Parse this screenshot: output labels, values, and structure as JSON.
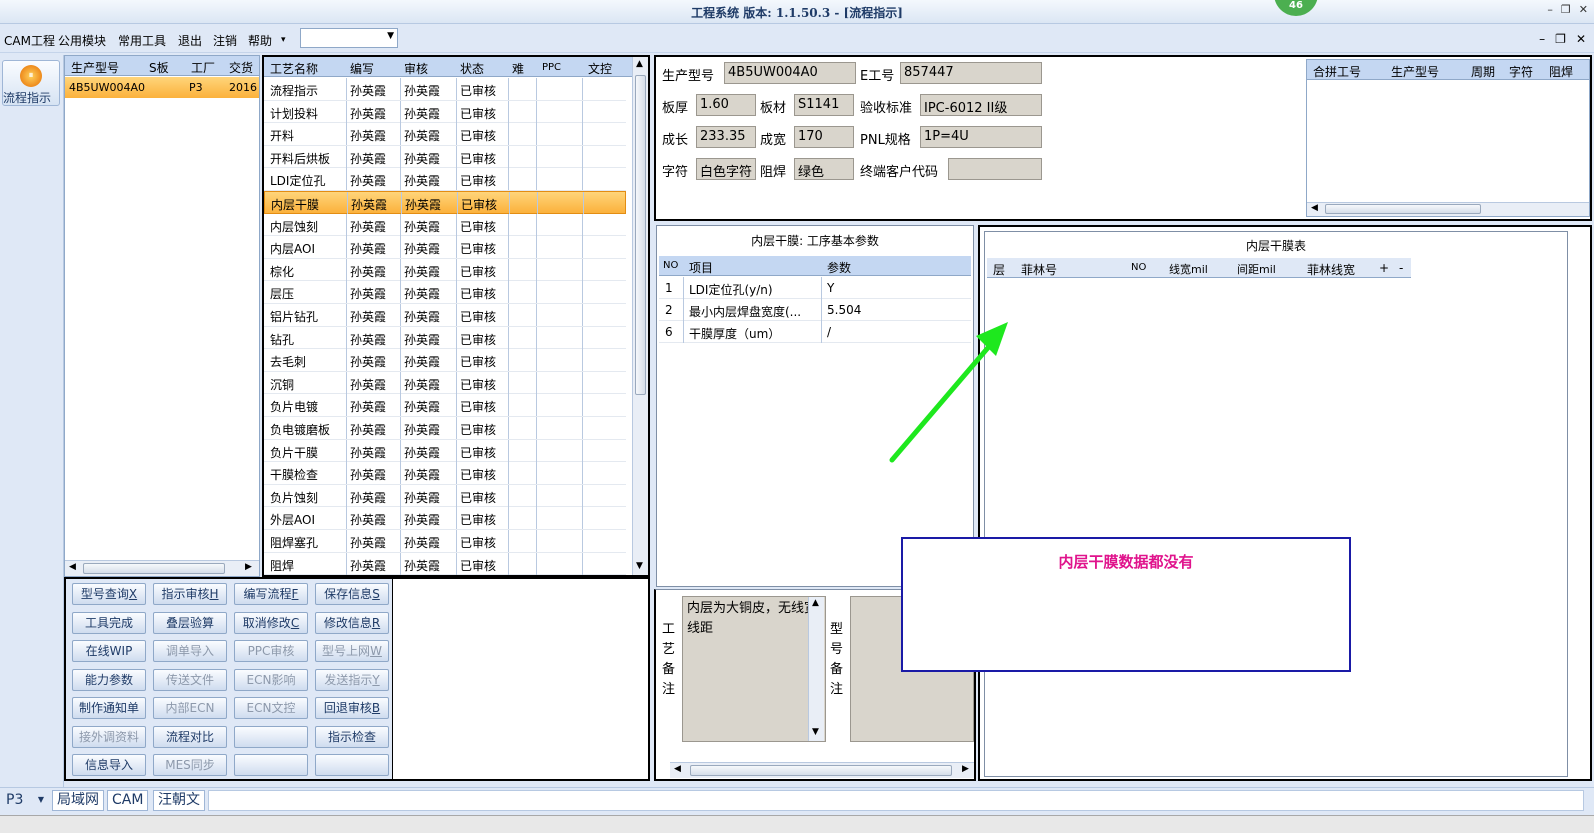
{
  "window": {
    "title": "工程系统    版本: 1.1.50.3 - [流程指示]",
    "badge": "46",
    "controls": [
      "–",
      "❐",
      "✕"
    ]
  },
  "menu": {
    "items": [
      "CAM工程",
      "公用模块",
      "常用工具",
      "退出",
      "注销",
      "帮助"
    ],
    "help_arrow": "▾",
    "combo_value": "",
    "mdi_controls": [
      "–",
      "❐",
      "✕"
    ]
  },
  "nav": {
    "flow_label": "流程指示"
  },
  "model_grid": {
    "headers": [
      "生产型号",
      "S板",
      "工厂",
      "交货日"
    ],
    "rows": [
      {
        "model": "4B5UW004A0",
        "s": "",
        "factory": "P3",
        "date": "2016"
      }
    ]
  },
  "process_grid": {
    "headers": [
      "工艺名称",
      "编写",
      "审核",
      "状态",
      "难",
      "PPC",
      "文控"
    ],
    "rows": [
      {
        "name": "流程指示",
        "writer": "孙英霞",
        "reviewer": "孙英霞",
        "status": "已审核"
      },
      {
        "name": "计划投料",
        "writer": "孙英霞",
        "reviewer": "孙英霞",
        "status": "已审核"
      },
      {
        "name": "开料",
        "writer": "孙英霞",
        "reviewer": "孙英霞",
        "status": "已审核"
      },
      {
        "name": "开料后烘板",
        "writer": "孙英霞",
        "reviewer": "孙英霞",
        "status": "已审核"
      },
      {
        "name": "LDI定位孔",
        "writer": "孙英霞",
        "reviewer": "孙英霞",
        "status": "已审核"
      },
      {
        "name": "内层干膜",
        "writer": "孙英霞",
        "reviewer": "孙英霞",
        "status": "已审核"
      },
      {
        "name": "内层蚀刻",
        "writer": "孙英霞",
        "reviewer": "孙英霞",
        "status": "已审核"
      },
      {
        "name": "内层AOI",
        "writer": "孙英霞",
        "reviewer": "孙英霞",
        "status": "已审核"
      },
      {
        "name": "棕化",
        "writer": "孙英霞",
        "reviewer": "孙英霞",
        "status": "已审核"
      },
      {
        "name": "层压",
        "writer": "孙英霞",
        "reviewer": "孙英霞",
        "status": "已审核"
      },
      {
        "name": "铝片钻孔",
        "writer": "孙英霞",
        "reviewer": "孙英霞",
        "status": "已审核"
      },
      {
        "name": "钻孔",
        "writer": "孙英霞",
        "reviewer": "孙英霞",
        "status": "已审核"
      },
      {
        "name": "去毛刺",
        "writer": "孙英霞",
        "reviewer": "孙英霞",
        "status": "已审核"
      },
      {
        "name": "沉铜",
        "writer": "孙英霞",
        "reviewer": "孙英霞",
        "status": "已审核"
      },
      {
        "name": "负片电镀",
        "writer": "孙英霞",
        "reviewer": "孙英霞",
        "status": "已审核"
      },
      {
        "name": "负电镀磨板",
        "writer": "孙英霞",
        "reviewer": "孙英霞",
        "status": "已审核"
      },
      {
        "name": "负片干膜",
        "writer": "孙英霞",
        "reviewer": "孙英霞",
        "status": "已审核"
      },
      {
        "name": "干膜检查",
        "writer": "孙英霞",
        "reviewer": "孙英霞",
        "status": "已审核"
      },
      {
        "name": "负片蚀刻",
        "writer": "孙英霞",
        "reviewer": "孙英霞",
        "status": "已审核"
      },
      {
        "name": "外层AOI",
        "writer": "孙英霞",
        "reviewer": "孙英霞",
        "status": "已审核"
      },
      {
        "name": "阻焊塞孔",
        "writer": "孙英霞",
        "reviewer": "孙英霞",
        "status": "已审核"
      },
      {
        "name": "阻焊",
        "writer": "孙英霞",
        "reviewer": "孙英霞",
        "status": "已审核"
      }
    ]
  },
  "buttons": [
    [
      {
        "label": "型号查询",
        "key": "X",
        "enabled": true
      },
      {
        "label": "指示审核",
        "key": "H",
        "enabled": true
      },
      {
        "label": "编写流程",
        "key": "F",
        "enabled": true
      },
      {
        "label": "保存信息",
        "key": "S",
        "enabled": true
      }
    ],
    [
      {
        "label": "工具完成",
        "key": "",
        "enabled": true
      },
      {
        "label": "叠层验算",
        "key": "",
        "enabled": true
      },
      {
        "label": "取消修改",
        "key": "C",
        "enabled": true
      },
      {
        "label": "修改信息",
        "key": "R",
        "enabled": true
      }
    ],
    [
      {
        "label": "在线WIP",
        "key": "",
        "enabled": true
      },
      {
        "label": "调单导入",
        "key": "",
        "enabled": false
      },
      {
        "label": "PPC审核",
        "key": "",
        "enabled": false
      },
      {
        "label": "型号上网",
        "key": "W",
        "enabled": false
      }
    ],
    [
      {
        "label": "能力参数",
        "key": "",
        "enabled": true
      },
      {
        "label": "传送文件",
        "key": "",
        "enabled": false
      },
      {
        "label": "ECN影响",
        "key": "",
        "enabled": false
      },
      {
        "label": "发送指示",
        "key": "Y",
        "enabled": false
      }
    ],
    [
      {
        "label": "制作通知单",
        "key": "",
        "enabled": true
      },
      {
        "label": "内部ECN",
        "key": "",
        "enabled": false
      },
      {
        "label": "ECN文控",
        "key": "",
        "enabled": false
      },
      {
        "label": "回退审核",
        "key": "B",
        "enabled": true
      }
    ],
    [
      {
        "label": "接外调资料",
        "key": "",
        "enabled": false
      },
      {
        "label": "流程对比",
        "key": "",
        "enabled": true
      },
      {
        "label": "",
        "key": "",
        "enabled": true
      },
      {
        "label": "指示检查",
        "key": "",
        "enabled": true
      }
    ],
    [
      {
        "label": "信息导入",
        "key": "",
        "enabled": true
      },
      {
        "label": "MES同步",
        "key": "",
        "enabled": false
      },
      {
        "label": "",
        "key": "",
        "enabled": true
      },
      {
        "label": "",
        "key": "",
        "enabled": true
      }
    ]
  ],
  "info": {
    "model_label": "生产型号",
    "model_value": "4B5UW004A0",
    "e_label": "E工号",
    "e_value": "857447",
    "thick_label": "板厚",
    "thick_value": "1.60",
    "material_label": "板材",
    "material_value": "S1141",
    "accept_label": "验收标准",
    "accept_value": "IPC-6012 II级",
    "length_label": "成长",
    "length_value": "233.35",
    "width_label": "成宽",
    "width_value": "170",
    "pnl_label": "PNL规格",
    "pnl_value": "1P=4U",
    "char_label": "字符",
    "char_value": "白色字符",
    "mask_label": "阻焊",
    "mask_value": "绿色",
    "customer_label": "终端客户代码",
    "customer_value": ""
  },
  "merge_grid": {
    "headers": [
      "合拼工号",
      "生产型号",
      "周期",
      "字符",
      "阻焊"
    ]
  },
  "params": {
    "title": "内层干膜: 工序基本参数",
    "headers": [
      "NO",
      "项目",
      "参数"
    ],
    "rows": [
      {
        "no": "1",
        "item": "LDI定位孔(y/n)",
        "value": "Y"
      },
      {
        "no": "2",
        "item": "最小内层焊盘宽度(...",
        "value": "5.504"
      },
      {
        "no": "6",
        "item": "干膜厚度（um）",
        "value": "/"
      }
    ]
  },
  "film_table": {
    "title": "内层干膜表",
    "headers": [
      "层",
      "菲林号",
      "NO",
      "线宽mil",
      "间距mil",
      "菲林线宽",
      "+",
      "-"
    ]
  },
  "notes": {
    "process_label": "工艺备注",
    "process_text": "内层为大铜皮，无线宽线距",
    "model_label": "型号备注",
    "model_text": ""
  },
  "callout": {
    "text": "内层干膜数据都没有",
    "color": "#e0138c",
    "arrow_color": "#1ee81e"
  },
  "status": {
    "factory": "P3",
    "tabs": [
      "局域网",
      "CAM",
      "汪朝文"
    ]
  },
  "colors": {
    "selected_row": "#fbb13c",
    "header": "#c4d7f2",
    "field": "#d9d5cc"
  }
}
